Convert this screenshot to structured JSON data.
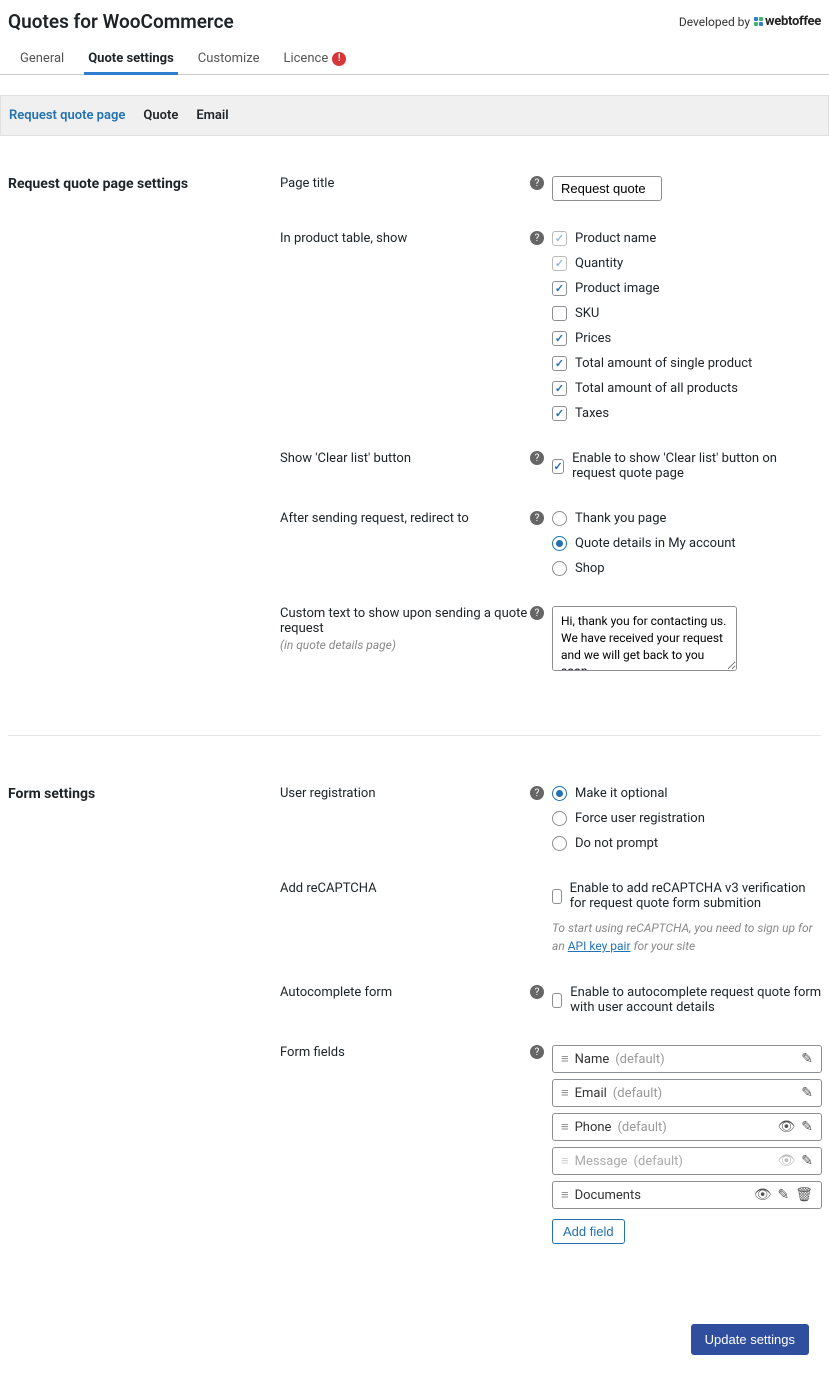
{
  "header": {
    "title": "Quotes for WooCommerce",
    "developed_by": "Developed by",
    "brand": "webtoffee"
  },
  "tabs": [
    {
      "label": "General",
      "active": false
    },
    {
      "label": "Quote settings",
      "active": true
    },
    {
      "label": "Customize",
      "active": false
    },
    {
      "label": "Licence",
      "active": false,
      "alert": true
    }
  ],
  "subtabs": [
    {
      "label": "Request quote page",
      "active": true
    },
    {
      "label": "Quote",
      "active": false
    },
    {
      "label": "Email",
      "active": false
    }
  ],
  "section1": {
    "title": "Request quote page settings",
    "page_title_label": "Page title",
    "page_title_value": "Request quote",
    "product_table_label": "In product table, show",
    "product_table_options": [
      {
        "label": "Product name",
        "checked": true,
        "locked": true
      },
      {
        "label": "Quantity",
        "checked": true,
        "locked": true
      },
      {
        "label": "Product image",
        "checked": true,
        "locked": false
      },
      {
        "label": "SKU",
        "checked": false,
        "locked": false
      },
      {
        "label": "Prices",
        "checked": true,
        "locked": false
      },
      {
        "label": "Total amount of single product",
        "checked": true,
        "locked": false
      },
      {
        "label": "Total amount of all products",
        "checked": true,
        "locked": false
      },
      {
        "label": "Taxes",
        "checked": true,
        "locked": false
      }
    ],
    "clear_list_label": "Show 'Clear list' button",
    "clear_list_option": "Enable to show 'Clear list' button on request quote page",
    "clear_list_checked": true,
    "redirect_label": "After sending request, redirect to",
    "redirect_options": [
      {
        "label": "Thank you page",
        "checked": false
      },
      {
        "label": "Quote details in My account",
        "checked": true
      },
      {
        "label": "Shop",
        "checked": false
      }
    ],
    "custom_text_label": "Custom text to show upon sending a quote request",
    "custom_text_sublabel": "(in quote details page)",
    "custom_text_value": "Hi, thank you for contacting us. We have received your request and we will get back to you soon."
  },
  "section2": {
    "title": "Form settings",
    "user_reg_label": "User registration",
    "user_reg_options": [
      {
        "label": "Make it optional",
        "checked": true
      },
      {
        "label": "Force user registration",
        "checked": false
      },
      {
        "label": "Do not prompt",
        "checked": false
      }
    ],
    "recaptcha_label": "Add reCAPTCHA",
    "recaptcha_option": "Enable to add reCAPTCHA v3 verification for request quote form submition",
    "recaptcha_checked": false,
    "recaptcha_hint_before": "To start using reCAPTCHA, you need to sign up for an ",
    "recaptcha_hint_link": "API key pair",
    "recaptcha_hint_after": " for your site",
    "autocomplete_label": "Autocomplete form",
    "autocomplete_option": "Enable to autocomplete request quote form with user account details",
    "autocomplete_checked": false,
    "form_fields_label": "Form fields",
    "form_fields": [
      {
        "name": "Name",
        "suffix": "(default)",
        "muted": false,
        "actions": [
          "edit"
        ]
      },
      {
        "name": "Email",
        "suffix": "(default)",
        "muted": false,
        "actions": [
          "edit"
        ]
      },
      {
        "name": "Phone",
        "suffix": "(default)",
        "muted": false,
        "actions": [
          "eye",
          "edit"
        ]
      },
      {
        "name": "Message",
        "suffix": "(default)",
        "muted": true,
        "actions": [
          "eye-off",
          "edit"
        ]
      },
      {
        "name": "Documents",
        "suffix": "",
        "muted": false,
        "actions": [
          "eye",
          "edit",
          "trash"
        ]
      }
    ],
    "add_field_label": "Add field"
  },
  "footer": {
    "submit_label": "Update settings"
  }
}
